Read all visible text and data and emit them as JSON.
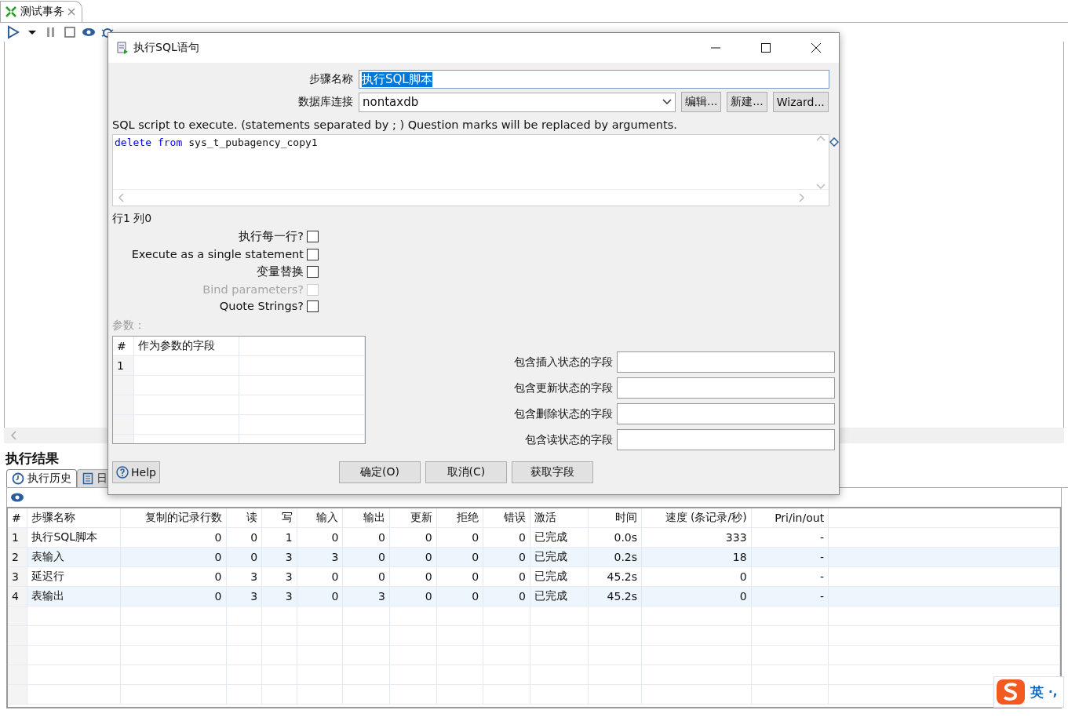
{
  "editor_tab": {
    "title": "测试事务"
  },
  "results": {
    "title": "执行结果",
    "tabs": [
      {
        "label": "执行历史",
        "selected": true,
        "kind": "history"
      },
      {
        "label": "日",
        "selected": false,
        "kind": "log"
      }
    ],
    "table": {
      "columns": [
        "#",
        "步骤名称",
        "复制的记录行数",
        "读",
        "写",
        "输入",
        "输出",
        "更新",
        "拒绝",
        "错误",
        "激活",
        "时间",
        "速度 (条记录/秒)",
        "Pri/in/out"
      ],
      "rows": [
        [
          "1",
          "执行SQL脚本",
          "0",
          "0",
          "1",
          "0",
          "0",
          "0",
          "0",
          "0",
          "已完成",
          "0.0s",
          "333",
          "-"
        ],
        [
          "2",
          "表输入",
          "0",
          "0",
          "3",
          "3",
          "0",
          "0",
          "0",
          "0",
          "已完成",
          "0.2s",
          "18",
          "-"
        ],
        [
          "3",
          "延迟行",
          "0",
          "3",
          "3",
          "0",
          "0",
          "0",
          "0",
          "0",
          "已完成",
          "45.2s",
          "0",
          "-"
        ],
        [
          "4",
          "表输出",
          "0",
          "3",
          "3",
          "0",
          "3",
          "0",
          "0",
          "0",
          "已完成",
          "45.2s",
          "0",
          "-"
        ]
      ]
    }
  },
  "dialog": {
    "title": "执行SQL语句",
    "step_name": {
      "label": "步骤名称",
      "value": "执行SQL脚本",
      "selected": true
    },
    "connection": {
      "label": "数据库连接",
      "value": "nontaxdb",
      "buttons": [
        "编辑...",
        "新建...",
        "Wizard..."
      ]
    },
    "sql_hint": "SQL script to execute. (statements separated by ; ) Question marks will be replaced by arguments.",
    "sql": [
      {
        "text": "delete",
        "kind": "keyword"
      },
      {
        "text": "from",
        "kind": "keyword"
      },
      {
        "text": "sys_t_pubagency_copy1",
        "kind": "plain"
      }
    ],
    "cursor": "行1 列0",
    "options": [
      {
        "label": "执行每一行?",
        "checked": false,
        "disabled": false
      },
      {
        "label": "Execute as a single statement",
        "checked": false,
        "disabled": false
      },
      {
        "label": "变量替换",
        "checked": false,
        "disabled": false
      },
      {
        "label": "Bind parameters?",
        "checked": false,
        "disabled": true
      },
      {
        "label": "Quote Strings?",
        "checked": false,
        "disabled": false
      }
    ],
    "params_label": "参数：",
    "params_table": {
      "columns": [
        "#",
        "作为参数的字段"
      ],
      "rows": [
        {
          "index": "1"
        }
      ]
    },
    "status_fields": [
      {
        "label": "包含插入状态的字段"
      },
      {
        "label": "包含更新状态的字段"
      },
      {
        "label": "包含删除状态的字段"
      },
      {
        "label": "包含读状态的字段"
      }
    ],
    "buttons": [
      {
        "label": "Help",
        "kind": "help"
      },
      {
        "label": "确定(O)",
        "kind": "plain"
      },
      {
        "label": "取消(C)",
        "kind": "plain"
      },
      {
        "label": "获取字段",
        "kind": "plain"
      }
    ]
  },
  "ime": {
    "mode": "英",
    "punct": "·,"
  }
}
